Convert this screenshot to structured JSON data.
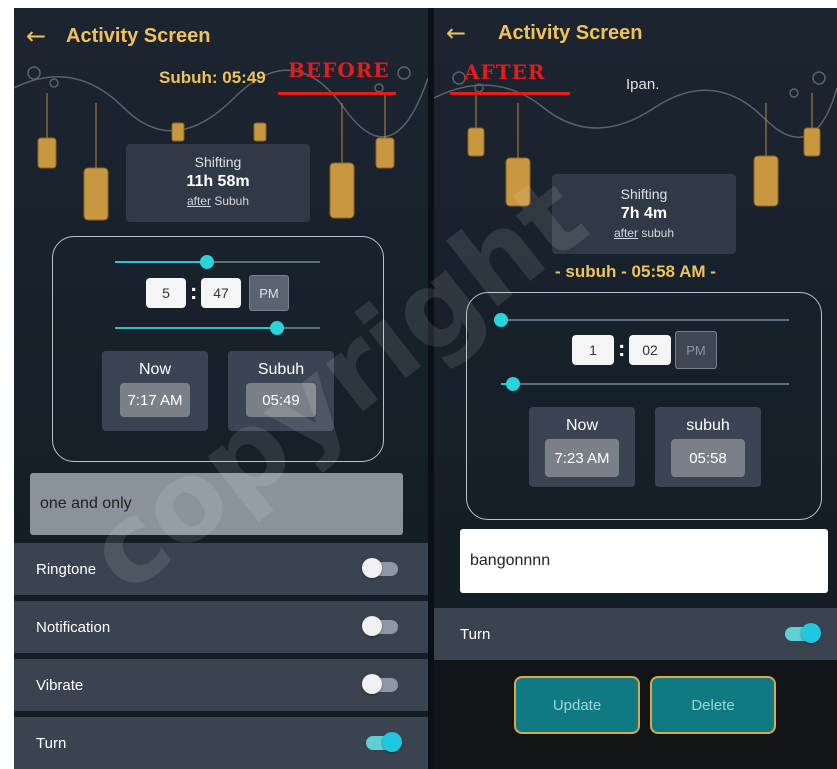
{
  "before": {
    "title": "Activity Screen",
    "prayer_label": "Subuh: 05:49",
    "tag": "BEFORE",
    "shifting": {
      "label": "Shifting",
      "duration": "11h 58m",
      "after_word": "after",
      "after_target": "Subuh"
    },
    "timer": {
      "hour": "5",
      "minute": "47",
      "ampm": "PM",
      "slider_top": 0.45,
      "slider_bottom": 0.79
    },
    "now": {
      "label": "Now",
      "value": "7:17 AM"
    },
    "prayer": {
      "label": "Subuh",
      "value": "05:49"
    },
    "name_input": "one and only",
    "settings": [
      {
        "label": "Ringtone",
        "on": false
      },
      {
        "label": "Notification",
        "on": false
      },
      {
        "label": "Vibrate",
        "on": false
      },
      {
        "label": "Turn",
        "on": true
      }
    ]
  },
  "after": {
    "title": "Activity Screen",
    "tag": "AFTER",
    "header_text": "Ipan.",
    "shifting": {
      "label": "Shifting",
      "duration": "7h 4m",
      "after_word": "after",
      "after_target": "subuh"
    },
    "prayer_banner": "- subuh - 05:58 AM -",
    "timer": {
      "hour": "1",
      "minute": "02",
      "ampm": "PM",
      "slider_top": 0.0,
      "slider_bottom": 0.04
    },
    "now": {
      "label": "Now",
      "value": "7:23 AM"
    },
    "prayer": {
      "label": "subuh",
      "value": "05:58"
    },
    "name_input": "bangonnnn",
    "turn": {
      "label": "Turn",
      "on": true
    },
    "update_label": "Update",
    "delete_label": "Delete"
  },
  "watermark": "copyright",
  "colors": {
    "accent_gold": "#f0c35a",
    "slider_teal": "#28c6cc",
    "tag_red": "#e31c1c",
    "button_teal": "#0f7a82"
  }
}
